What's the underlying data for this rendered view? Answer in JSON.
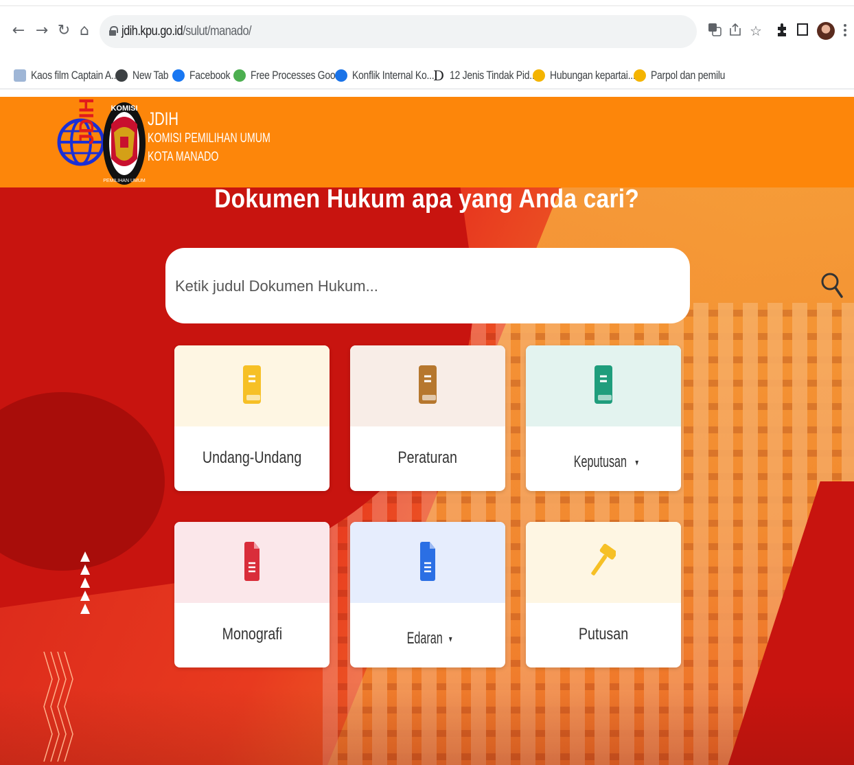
{
  "browser": {
    "url_host": "jdih.kpu.go.id",
    "url_path": "/sulut/manado/",
    "nav": {
      "back_icon": "arrow-left-icon",
      "forward_icon": "arrow-right-icon",
      "reload_icon": "reload-icon",
      "home_icon": "home-icon"
    },
    "bookmarks": [
      {
        "label": "Kaos film Captain A...",
        "icon_color": "#9fb6d6"
      },
      {
        "label": "New Tab",
        "icon_color": "#3c4043"
      },
      {
        "label": "Facebook",
        "icon_color": "#1877f2"
      },
      {
        "label": "Free Processes Goo...",
        "icon_color": "#4caf50"
      },
      {
        "label": "Konflik Internal Ko...",
        "icon_color": "#1a73e8"
      },
      {
        "label": "12 Jenis Tindak Pid...",
        "icon_color": "#202124"
      },
      {
        "label": "Hubungan kepartai...",
        "icon_color": "#f4b400"
      },
      {
        "label": "Parpol dan pemilu",
        "icon_color": "#f4b400"
      }
    ]
  },
  "site": {
    "header_bg": "#fd860a",
    "brand_line1": "JDIH",
    "brand_line2": "KOMISI PEMILIHAN UMUM",
    "brand_line3": "KOTA MANADO",
    "logo_text_jdih": "JDIH",
    "logo_text_komisi": "KOMISI",
    "logo_text_pemilihan": "PEMILIHAN UMUM"
  },
  "hero": {
    "title": "Dokumen Hukum apa yang Anda cari?",
    "search_placeholder": "Ketik judul Dokumen Hukum..."
  },
  "categories": [
    {
      "label": "Undang-Undang",
      "icon": "book-icon",
      "icon_color": "#f6c026",
      "bg": "#fef6e3",
      "dropdown": false
    },
    {
      "label": "Peraturan",
      "icon": "book-icon",
      "icon_color": "#b6772e",
      "bg": "#f8ede7",
      "dropdown": false
    },
    {
      "label": "Keputusan",
      "icon": "book-icon",
      "icon_color": "#1f9d7c",
      "bg": "#e3f3ef",
      "dropdown": true
    },
    {
      "label": "Monografi",
      "icon": "document-icon",
      "icon_color": "#d92d3a",
      "bg": "#fbe7ea",
      "dropdown": false
    },
    {
      "label": "Edaran",
      "icon": "document-icon",
      "icon_color": "#2b6fe4",
      "bg": "#e6edfd",
      "dropdown": true
    },
    {
      "label": "Putusan",
      "icon": "gavel-icon",
      "icon_color": "#f6c026",
      "bg": "#fef6e3",
      "dropdown": false
    }
  ],
  "caret_glyph": "▾"
}
